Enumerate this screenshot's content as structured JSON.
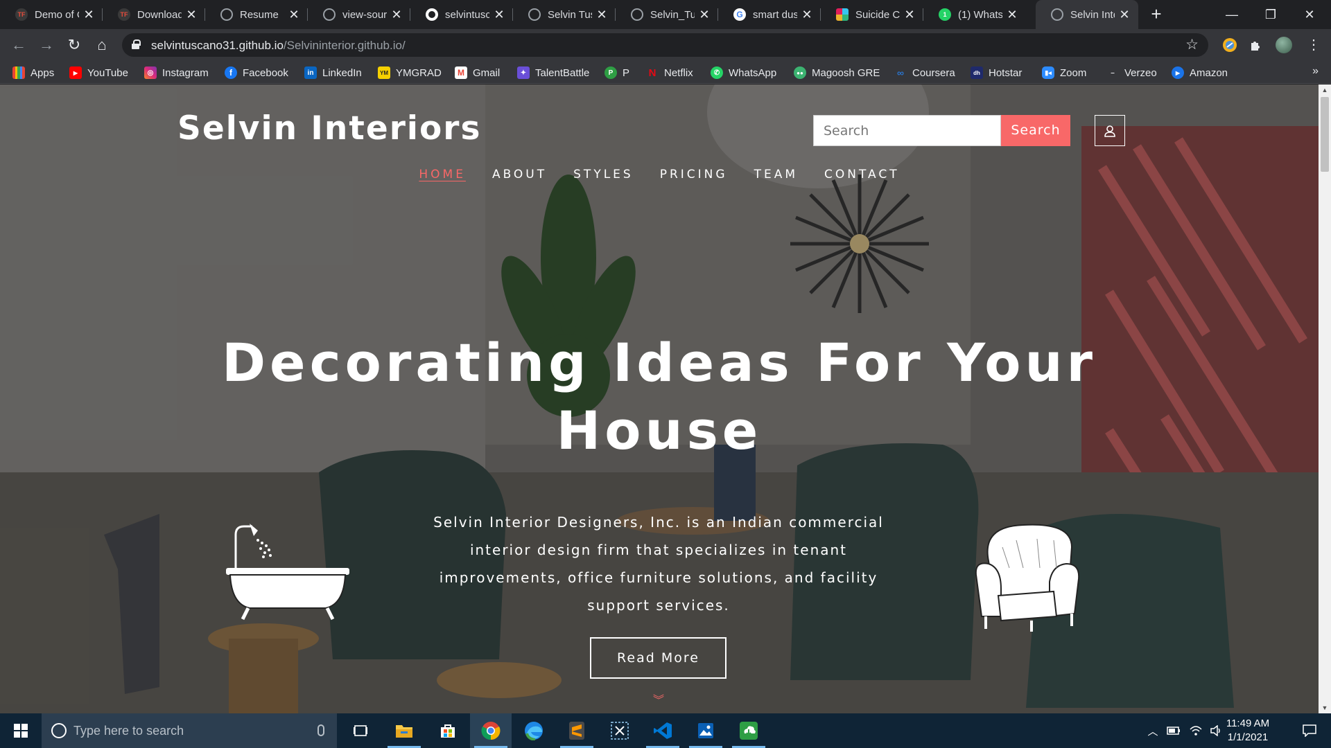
{
  "browser": {
    "tabs": [
      {
        "title": "Demo of C",
        "icon": "tf-icon",
        "color": "#c0392b"
      },
      {
        "title": "Download",
        "icon": "tf-icon",
        "color": "#c0392b"
      },
      {
        "title": "Resume",
        "icon": "globe-icon",
        "color": "#9aa0a6"
      },
      {
        "title": "view-sour",
        "icon": "globe-icon",
        "color": "#9aa0a6"
      },
      {
        "title": "selvintusc",
        "icon": "github-icon",
        "color": "#ffffff"
      },
      {
        "title": "Selvin Tus",
        "icon": "globe-icon",
        "color": "#9aa0a6"
      },
      {
        "title": "Selvin_Tus",
        "icon": "globe-icon",
        "color": "#9aa0a6"
      },
      {
        "title": "smart dus",
        "icon": "google-icon",
        "color": "#4285f4"
      },
      {
        "title": "Suicide Ca",
        "icon": "slack-icon",
        "color": "#e01e5a"
      },
      {
        "title": "(1) Whats",
        "icon": "whatsapp-icon",
        "color": "#25d366"
      },
      {
        "title": "Selvin Inte",
        "icon": "globe-icon",
        "color": "#9aa0a6",
        "active": true
      }
    ],
    "url_host": "selvintuscano31.github.io",
    "url_path": "/Selvininterior.github.io/",
    "bookmarks": [
      {
        "label": "Apps",
        "icon": "apps-grid-icon",
        "color": "#f4b400"
      },
      {
        "label": "YouTube",
        "icon": "youtube-icon",
        "color": "#ff0000"
      },
      {
        "label": "Instagram",
        "icon": "instagram-icon",
        "color": "#c13584"
      },
      {
        "label": "Facebook",
        "icon": "facebook-icon",
        "color": "#1877f2"
      },
      {
        "label": "LinkedIn",
        "icon": "linkedin-icon",
        "color": "#0a66c2"
      },
      {
        "label": "YMGRAD",
        "icon": "ymgrad-icon",
        "color": "#f5d000"
      },
      {
        "label": "Gmail",
        "icon": "gmail-icon",
        "color": "#ea4335"
      },
      {
        "label": "TalentBattle",
        "icon": "talentbattle-icon",
        "color": "#6a4fd8"
      },
      {
        "label": "P",
        "icon": "p-icon",
        "color": "#2e9e44"
      },
      {
        "label": "Netflix",
        "icon": "netflix-icon",
        "color": "#e50914"
      },
      {
        "label": "WhatsApp",
        "icon": "whatsapp-icon",
        "color": "#25d366"
      },
      {
        "label": "Magoosh GRE",
        "icon": "magoosh-icon",
        "color": "#3cb371"
      },
      {
        "label": "Coursera",
        "icon": "coursera-icon",
        "color": "#2a73cc"
      },
      {
        "label": "Hotstar",
        "icon": "hotstar-icon",
        "color": "#1f2a6b"
      },
      {
        "label": "Zoom",
        "icon": "zoom-icon",
        "color": "#2d8cff"
      },
      {
        "label": "Verzeo",
        "icon": "verzeo-icon",
        "color": "#444444"
      },
      {
        "label": "Amazon",
        "icon": "amazon-icon",
        "color": "#1a73e8"
      }
    ]
  },
  "site": {
    "logo": "Selvin Interiors",
    "search_placeholder": "Search",
    "search_button": "Search",
    "nav": [
      "HOME",
      "ABOUT",
      "STYLES",
      "PRICING",
      "TEAM",
      "CONTACT"
    ],
    "active_nav": "HOME",
    "hero_title": "Decorating Ideas For Your House",
    "hero_text": "Selvin Interior Designers, Inc. is an Indian commercial interior design firm that specializes in tenant improvements, office furniture solutions, and facility support services.",
    "read_more": "Read More",
    "accent_color": "#f86868"
  },
  "taskbar": {
    "search_placeholder": "Type here to search",
    "time": "11:49 AM",
    "date": "1/1/2021",
    "apps": [
      "task-view-icon",
      "file-explorer-icon",
      "microsoft-store-icon",
      "chrome-icon",
      "edge-icon",
      "sublime-text-icon",
      "snipping-tool-icon",
      "vscode-icon",
      "photos-icon",
      "green-app-icon"
    ]
  }
}
